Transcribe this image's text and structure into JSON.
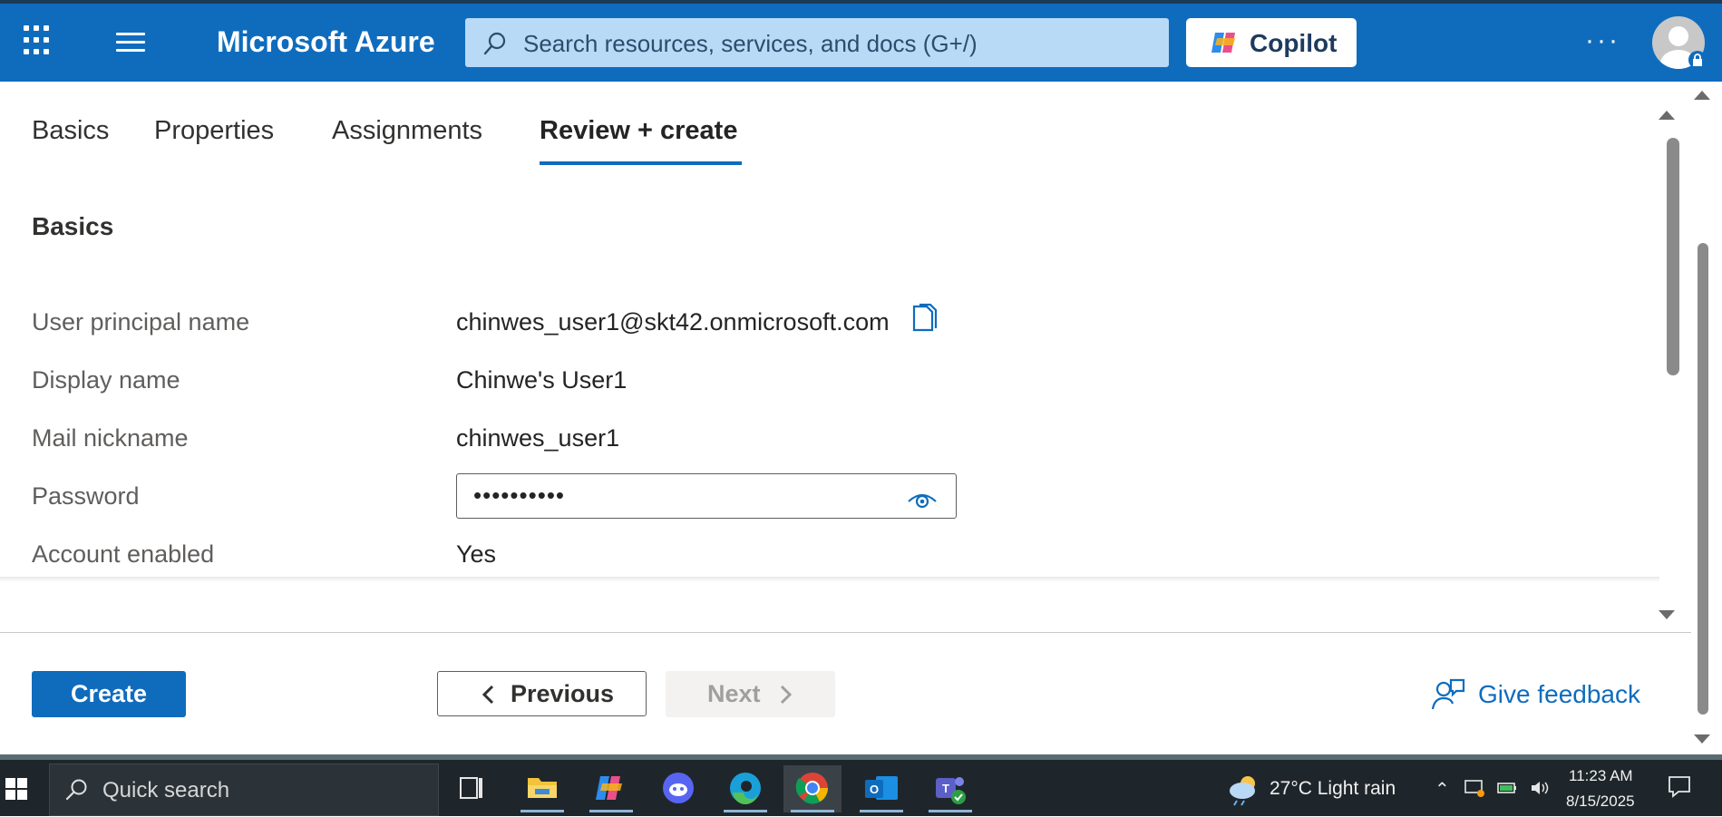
{
  "header": {
    "brand": "Microsoft Azure",
    "search_placeholder": "Search resources, services, and docs (G+/)",
    "copilot_label": "Copilot",
    "more_label": "···",
    "accent_color": "#0f6cbd"
  },
  "tabs": [
    {
      "label": "Basics",
      "active": false
    },
    {
      "label": "Properties",
      "active": false
    },
    {
      "label": "Assignments",
      "active": false
    },
    {
      "label": "Review + create",
      "active": true
    }
  ],
  "section_title": "Basics",
  "fields": {
    "upn": {
      "label": "User principal name",
      "value": "chinwes_user1@skt42.onmicrosoft.com"
    },
    "display_name": {
      "label": "Display name",
      "value": "Chinwe's User1"
    },
    "mail_nickname": {
      "label": "Mail nickname",
      "value": "chinwes_user1"
    },
    "password": {
      "label": "Password",
      "value": "••••••••••"
    },
    "account_enabled": {
      "label": "Account enabled",
      "value": "Yes"
    }
  },
  "footer": {
    "create_label": "Create",
    "previous_label": "Previous",
    "next_label": "Next",
    "feedback_label": "Give feedback"
  },
  "taskbar": {
    "search_label": "Quick search",
    "weather": "27°C  Light rain",
    "time": "11:23 AM",
    "date": "8/15/2025",
    "apps": [
      "task-view",
      "file-explorer",
      "copilot",
      "discord",
      "edge",
      "chrome",
      "outlook",
      "teams"
    ]
  }
}
